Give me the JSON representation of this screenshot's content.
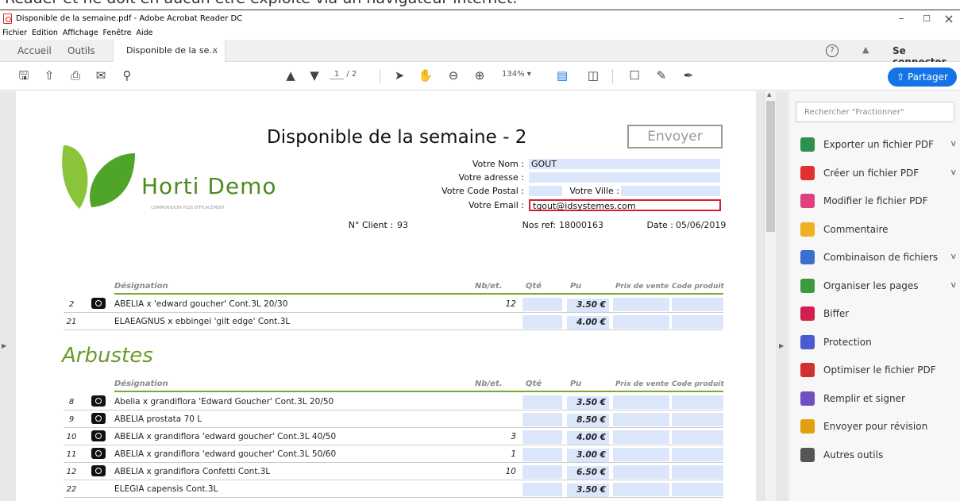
{
  "top_caption": "Reader et ne doit en aucun être exploité via un navigateur internet.",
  "window": {
    "title": "Disponible de la semaine.pdf - Adobe Acrobat Reader DC",
    "minimize": "–",
    "maximize": "☐",
    "close": "×"
  },
  "menu": [
    "Fichier",
    "Edition",
    "Affichage",
    "Fenêtre",
    "Aide"
  ],
  "tabs": {
    "home": "Accueil",
    "tools": "Outils",
    "doc": "Disponible de la se...",
    "close": "×"
  },
  "topright": {
    "help": "?",
    "bell": "🔔",
    "login": "Se connecter"
  },
  "toolbar": {
    "page_current": "1",
    "page_total": "/ 2",
    "zoom": "134%",
    "share": "Partager"
  },
  "panel": {
    "search_placeholder": "Rechercher \"Fractionner\"",
    "tools": [
      {
        "label": "Exporter un fichier PDF",
        "color": "#2f8f4e",
        "chevron": "v"
      },
      {
        "label": "Créer un fichier PDF",
        "color": "#e03030",
        "chevron": "v"
      },
      {
        "label": "Modifier le fichier PDF",
        "color": "#e04080",
        "chevron": ""
      },
      {
        "label": "Commentaire",
        "color": "#f0b020",
        "chevron": ""
      },
      {
        "label": "Combinaison de fichiers",
        "color": "#3a6fd0",
        "chevron": "v"
      },
      {
        "label": "Organiser les pages",
        "color": "#3c9a3c",
        "chevron": "v"
      },
      {
        "label": "Biffer",
        "color": "#d02050",
        "chevron": ""
      },
      {
        "label": "Protection",
        "color": "#4a5bd0",
        "chevron": ""
      },
      {
        "label": "Optimiser le fichier PDF",
        "color": "#d03030",
        "chevron": ""
      },
      {
        "label": "Remplir et signer",
        "color": "#7050c0",
        "chevron": ""
      },
      {
        "label": "Envoyer pour révision",
        "color": "#e0a010",
        "chevron": ""
      },
      {
        "label": "Autres outils",
        "color": "#555555",
        "chevron": ""
      }
    ]
  },
  "doc": {
    "title": "Disponible de la semaine - 2",
    "send_button": "Envoyer",
    "logo_name": "Horti Demo",
    "logo_tagline": "Communiquer plus efficacement",
    "labels": {
      "nom": "Votre Nom :",
      "adresse": "Votre adresse :",
      "cp": "Votre Code Postal :",
      "ville": "Votre Ville :",
      "email": "Votre Email :",
      "client": "N° Client :",
      "ref": "Nos ref:",
      "date": "Date :"
    },
    "values": {
      "nom": "GOUT",
      "email": "tgout@idsystemes.com",
      "client": "93",
      "ref": "18000163",
      "date": "05/06/2019"
    },
    "columns": {
      "designation": "Désignation",
      "nb": "Nb/et.",
      "qte": "Qté",
      "pu": "Pu",
      "pv": "Prix de vente",
      "cp": "Code produit"
    },
    "rows_top": [
      {
        "n": "2",
        "cam": true,
        "designation": "ABELIA x 'edward goucher' Cont.3L 20/30",
        "nb": "12",
        "pu": "3.50 €"
      },
      {
        "n": "21",
        "cam": false,
        "designation": "ELAEAGNUS x ebbingei 'gilt edge' Cont.3L",
        "nb": "",
        "pu": "4.00 €"
      }
    ],
    "section": "Arbustes",
    "rows_arbustes": [
      {
        "n": "8",
        "cam": true,
        "designation": "Abelia x grandiflora 'Edward Goucher' Cont.3L 20/50",
        "nb": "",
        "pu": "3.50 €"
      },
      {
        "n": "9",
        "cam": true,
        "designation": "ABELIA prostata 70 L",
        "nb": "",
        "pu": "8.50 €"
      },
      {
        "n": "10",
        "cam": true,
        "designation": "ABELIA x grandiflora 'edward goucher' Cont.3L 40/50",
        "nb": "3",
        "pu": "4.00 €"
      },
      {
        "n": "11",
        "cam": true,
        "designation": "ABELIA x grandiflora 'edward goucher' Cont.3L 50/60",
        "nb": "1",
        "pu": "3.00 €"
      },
      {
        "n": "12",
        "cam": true,
        "designation": "ABELIA x grandiflora Confetti Cont.3L",
        "nb": "10",
        "pu": "6.50 €"
      },
      {
        "n": "22",
        "cam": false,
        "designation": "ELEGIA capensis Cont.3L",
        "nb": "",
        "pu": "3.50 €"
      }
    ]
  }
}
